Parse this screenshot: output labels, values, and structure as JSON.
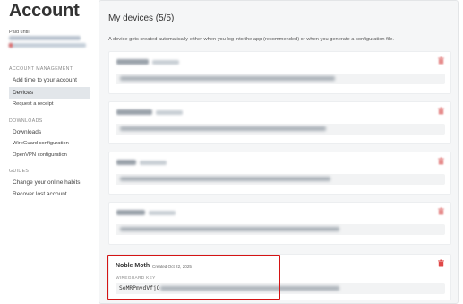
{
  "sidebar": {
    "title": "Account",
    "paid_until_label": "Paid until",
    "sections": {
      "account_management": "ACCOUNT MANAGEMENT",
      "downloads": "DOWNLOADS",
      "guides": "GUIDES"
    },
    "items": {
      "add_time": "Add time to your account",
      "devices": "Devices",
      "request_receipt": "Request a receipt",
      "downloads": "Downloads",
      "wireguard_config": "WireGuard configuration",
      "openvpn_config": "OpenVPN configuration",
      "change_habits": "Change your online habits",
      "recover_account": "Recover lost account"
    }
  },
  "main": {
    "title": "My devices (5/5)",
    "intro": "A device gets created automatically either when you log into the app (recommended) or when you generate a configuration file.",
    "highlighted_device": {
      "name": "Noble Moth",
      "created": "Created Oct 22, 2025",
      "key_label": "WIREGUARD KEY",
      "key_value": "SeMRPmvdVfjQ"
    }
  },
  "colors": {
    "delete_icon": "#e04848",
    "highlight_border": "#d41414",
    "active_nav": "#e2e6ea"
  },
  "icons": {
    "delete": "trash-icon"
  }
}
